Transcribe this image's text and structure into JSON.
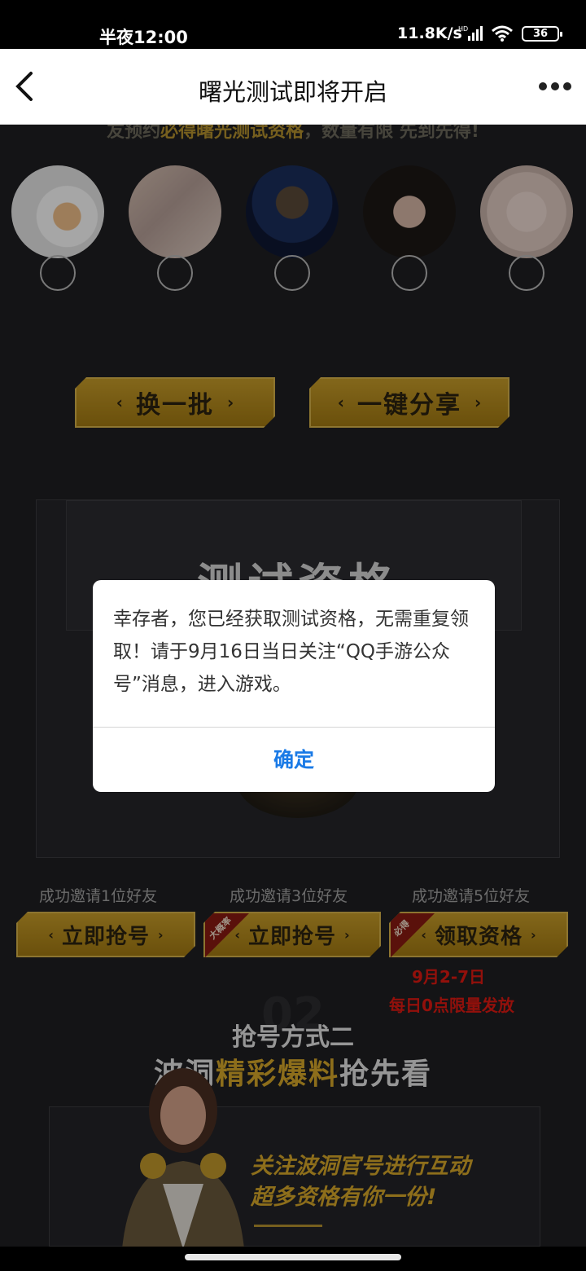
{
  "status_bar": {
    "time": "半夜12:00",
    "network_speed": "11.8K/s",
    "hd_label": "HD",
    "battery": "36"
  },
  "nav": {
    "title": "曙光测试即将开启",
    "back_icon": "chevron-left-icon",
    "more_icon": "more-dots-icon"
  },
  "banner": {
    "text_prefix": "友预约",
    "text_highlight": "必得曙光测试资格",
    "text_suffix": "，数量有限 先到先得!"
  },
  "buttons": {
    "refresh": "换一批",
    "share": "一键分享",
    "grab_1": "立即抢号",
    "grab_3": "立即抢号",
    "claim": "领取资格"
  },
  "tags": {
    "likely": "大概率",
    "guaranteed": "必得"
  },
  "envelope": {
    "title": "测试资格"
  },
  "invites": {
    "one": "成功邀请1位好友",
    "three": "成功邀请3位好友",
    "five": "成功邀请5位好友"
  },
  "notes": {
    "date_range": "9月2-7日",
    "daily_release": "每日0点限量发放"
  },
  "section2": {
    "number": "02",
    "method": "抢号方式二",
    "head_pre": "波洞",
    "head_gold": "精彩爆料",
    "head_post": "抢先看"
  },
  "panel": {
    "line1": "关注波洞官号进行互动",
    "line2": "超多资格有你一份!"
  },
  "dialog": {
    "message": "幸存者，您已经获取测试资格，无需重复领取！请于9月16日当日关注“QQ手游公众号”消息，进入游戏。",
    "confirm": "确定"
  },
  "colors": {
    "gold": "#d9aa2a",
    "link_blue": "#1a7ae6",
    "alert_red": "#e21a12"
  }
}
